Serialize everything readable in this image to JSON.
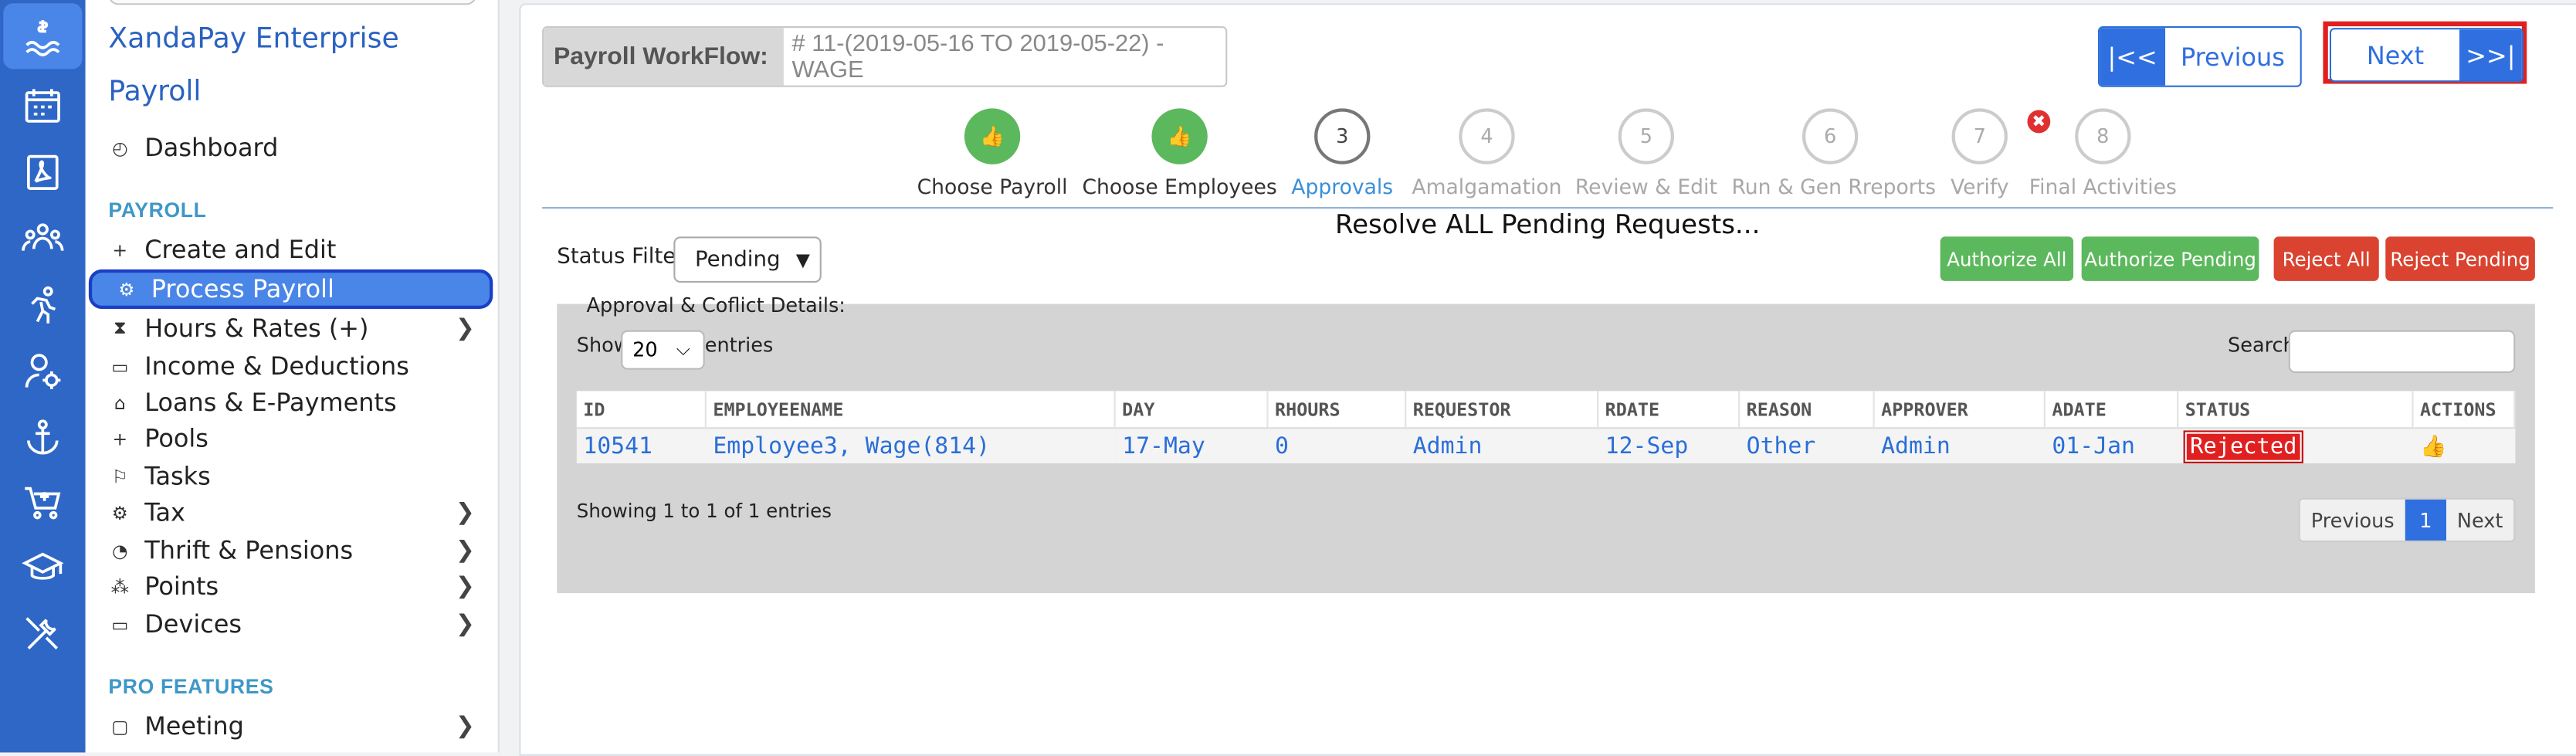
{
  "brand": {
    "line1": "XandaPay Enterprise",
    "line2": "Payroll"
  },
  "rail": {
    "icons": [
      "payroll-icon",
      "calendar-icon",
      "pdf-icon",
      "people-icon",
      "runner-icon",
      "user-settings-icon",
      "anchor-icon",
      "cart-icon",
      "graduation-icon",
      "tools-icon"
    ]
  },
  "sidebar": {
    "dashboard": "Dashboard",
    "section_payroll": "PAYROLL",
    "items": [
      {
        "label": "Create and Edit",
        "icon": "+"
      },
      {
        "label": "Process Payroll",
        "icon": "⚙"
      },
      {
        "label": "Hours & Rates (+)",
        "icon": "⧗"
      },
      {
        "label": "Income & Deductions",
        "icon": "▭"
      },
      {
        "label": "Loans & E-Payments",
        "icon": "⌂"
      },
      {
        "label": "Pools",
        "icon": "+"
      },
      {
        "label": "Tasks",
        "icon": "⚐"
      },
      {
        "label": "Tax",
        "icon": "⚙"
      },
      {
        "label": "Thrift & Pensions",
        "icon": "◔"
      },
      {
        "label": "Points",
        "icon": "⁂"
      },
      {
        "label": "Devices",
        "icon": "▭"
      }
    ],
    "section_pro": "PRO FEATURES",
    "meeting": "Meeting"
  },
  "workflow": {
    "label": "Payroll WorkFlow:",
    "value": "# 11-(2019-05-16 TO 2019-05-22) - WAGE"
  },
  "nav": {
    "first": "|<<",
    "previous": "Previous",
    "next": "Next",
    "last": ">>|"
  },
  "steps": [
    {
      "num": "",
      "label": "Choose Payroll",
      "state": "done"
    },
    {
      "num": "",
      "label": "Choose Employees",
      "state": "done"
    },
    {
      "num": "3",
      "label": "Approvals",
      "state": "cur"
    },
    {
      "num": "4",
      "label": "Amalgamation",
      "state": "todo"
    },
    {
      "num": "5",
      "label": "Review & Edit",
      "state": "todo"
    },
    {
      "num": "6",
      "label": "Run & Gen Rreports",
      "state": "todo"
    },
    {
      "num": "7",
      "label": "Verify",
      "state": "todo"
    },
    {
      "num": "8",
      "label": "Final Activities",
      "state": "todo"
    }
  ],
  "verify_badge": "✖",
  "heading": "Resolve ALL Pending Requests...",
  "status_filter": {
    "label": "Status Filter:",
    "value": "Pending"
  },
  "actions": {
    "authorize_all": "Authorize All",
    "authorize_pending": "Authorize Pending",
    "reject_all": "Reject All",
    "reject_pending": "Reject Pending"
  },
  "details": {
    "title": "Approval & Coflict Details:",
    "show": "Show",
    "page_size": "20",
    "entries": "entries",
    "search_label": "Search:",
    "search_value": "",
    "columns": [
      "ID",
      "EMPLOYEENAME",
      "DAY",
      "RHOURS",
      "REQUESTOR",
      "RDATE",
      "REASON",
      "APPROVER",
      "ADATE",
      "STATUS",
      "ACTIONS"
    ],
    "rows": [
      [
        "10541",
        "Employee3, Wage(814)",
        "17-May",
        "0",
        "Admin",
        "12-Sep",
        "Other",
        "Admin",
        "01-Jan",
        "Rejected",
        ""
      ]
    ],
    "showing": "Showing 1 to 1 of 1 entries",
    "pager": {
      "previous": "Previous",
      "page": "1",
      "next": "Next"
    }
  },
  "colors": {
    "rail": "#2f67c7",
    "accent": "#2f6fe0",
    "success": "#5cb85c",
    "danger": "#d9432f"
  }
}
